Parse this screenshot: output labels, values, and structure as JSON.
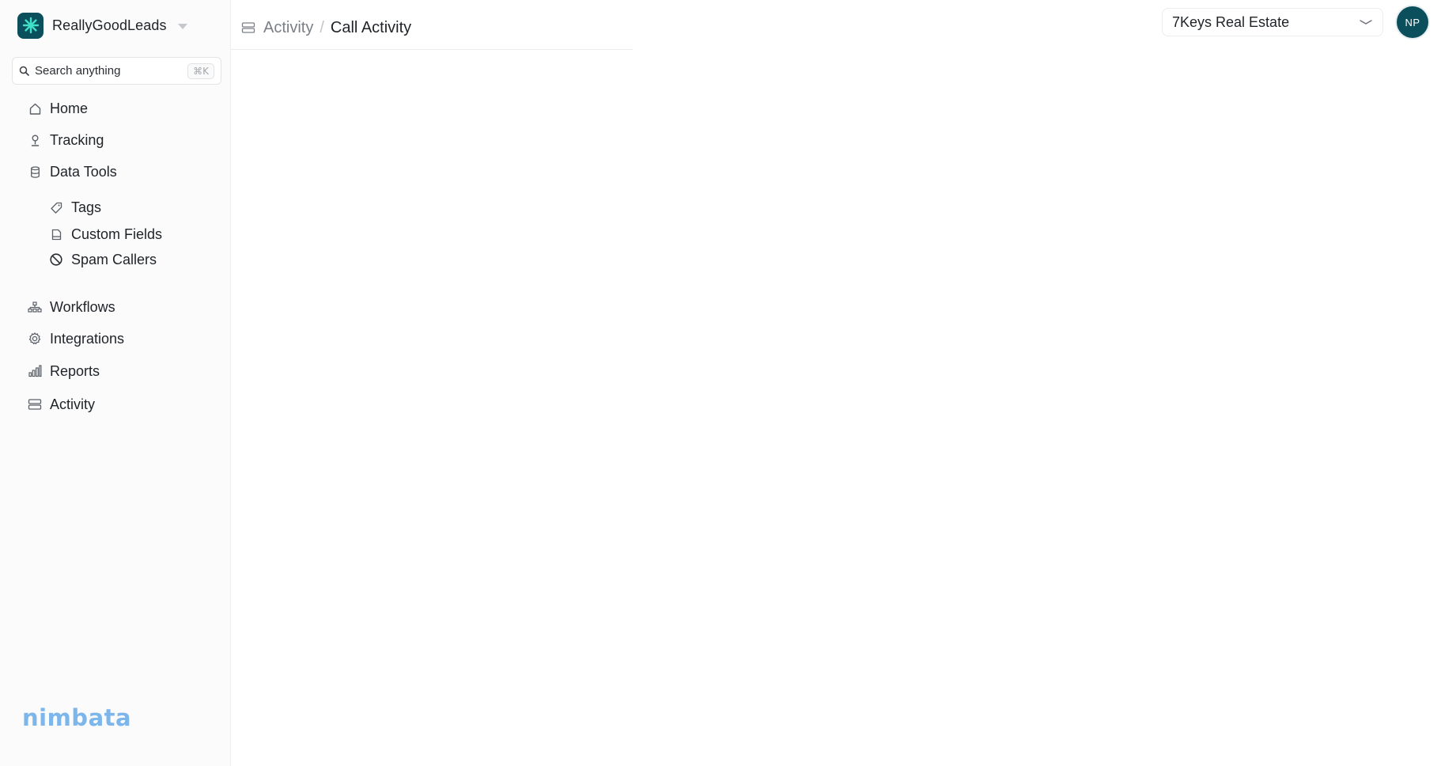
{
  "brand": {
    "name": "ReallyGoodLeads",
    "logo_color": "#0b4f5c",
    "logo_icon": "asterisk-icon"
  },
  "search": {
    "placeholder": "Search anything",
    "shortcut": "⌘K"
  },
  "sidebar": {
    "items": [
      {
        "label": "Home",
        "icon": "home-icon"
      },
      {
        "label": "Tracking",
        "icon": "tracking-icon"
      },
      {
        "label": "Data Tools",
        "icon": "database-icon"
      },
      {
        "label": "Workflows",
        "icon": "workflow-icon"
      },
      {
        "label": "Integrations",
        "icon": "gear-icon"
      },
      {
        "label": "Reports",
        "icon": "bar-chart-icon"
      },
      {
        "label": "Activity",
        "icon": "activity-icon"
      }
    ],
    "data_tools_children": [
      {
        "label": "Tags",
        "icon": "tag-icon"
      },
      {
        "label": "Custom Fields",
        "icon": "document-icon"
      },
      {
        "label": "Spam Callers",
        "icon": "block-icon"
      }
    ]
  },
  "footer": {
    "logo_text": "nimbata",
    "logo_color": "#7db6ea"
  },
  "header": {
    "breadcrumb": {
      "parent": "Activity",
      "separator": "/",
      "current": "Call Activity"
    },
    "account_select": {
      "value": "7Keys Real Estate"
    },
    "avatar": {
      "initials": "NP",
      "color": "#0b4f5c"
    }
  }
}
